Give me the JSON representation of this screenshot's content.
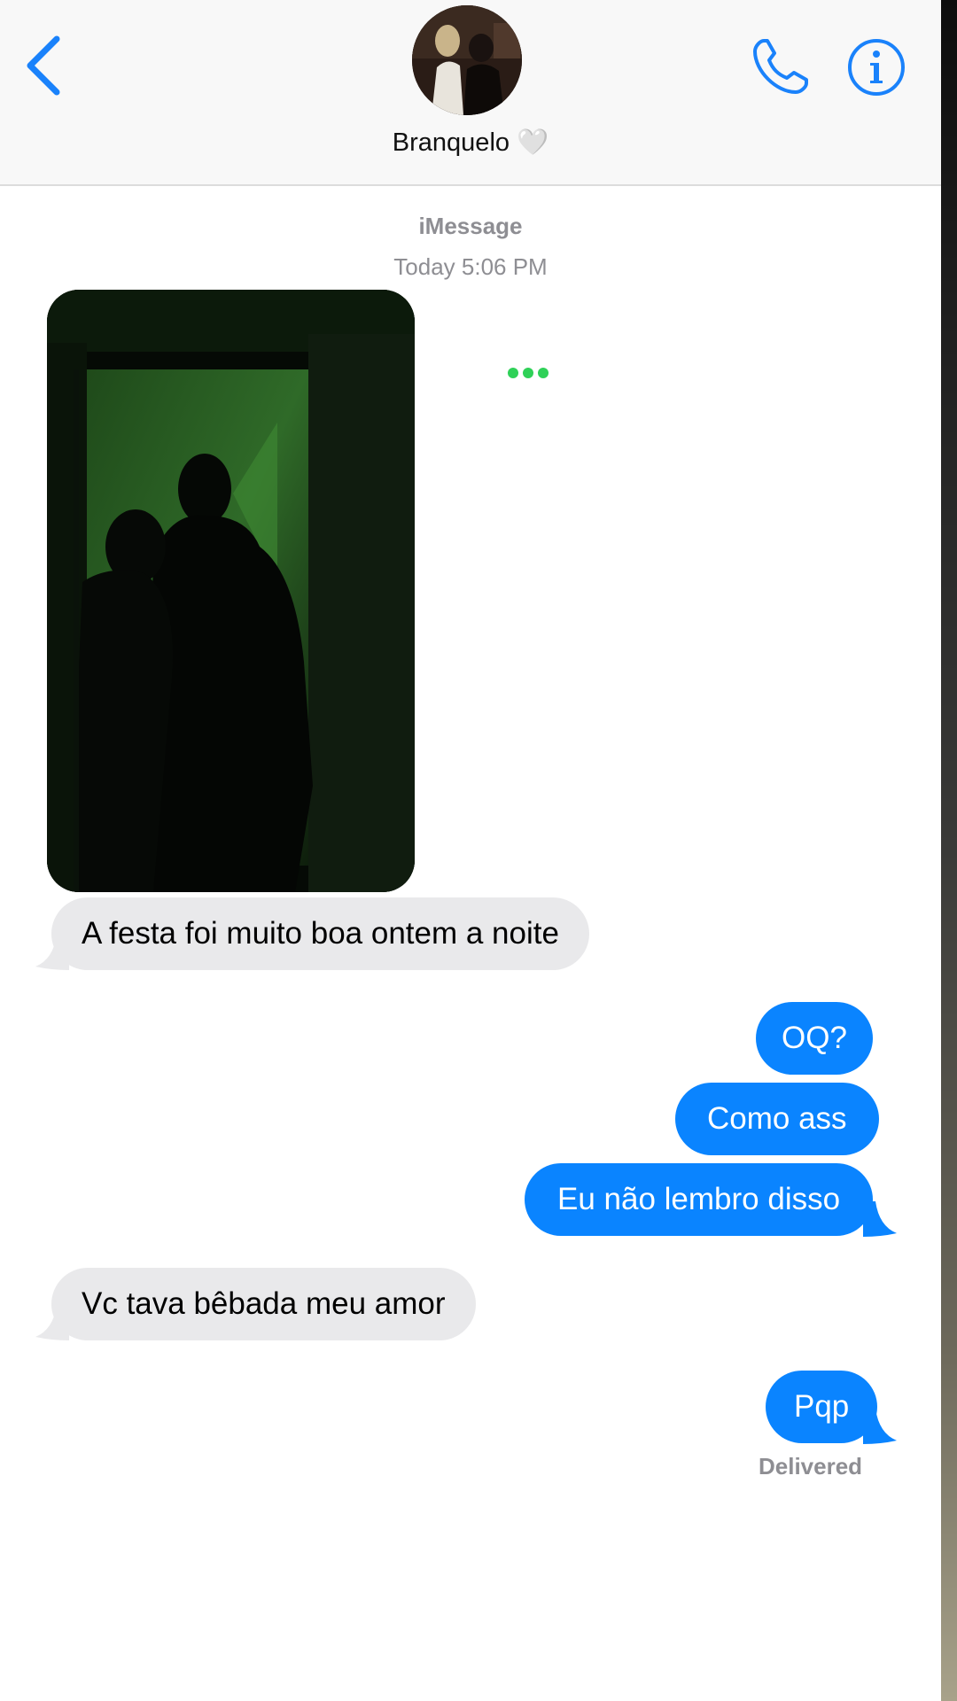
{
  "header": {
    "back_label": "Back",
    "contact_name": "Branquelo 🤍",
    "icons": [
      "chevron-left-icon",
      "phone-icon",
      "info-icon"
    ],
    "accent_color": "#1a82fb"
  },
  "conversation": {
    "service": "iMessage",
    "timestamp": "Today 5:06 PM",
    "typing_indicator_color": "#2fd158",
    "messages": [
      {
        "direction": "incoming",
        "type": "image"
      },
      {
        "direction": "incoming",
        "text": "A festa foi muito boa ontem a noite"
      },
      {
        "direction": "outgoing",
        "text": "OQ?"
      },
      {
        "direction": "outgoing",
        "text": "Como ass"
      },
      {
        "direction": "outgoing",
        "text": "Eu não lembro disso"
      },
      {
        "direction": "incoming",
        "text": "Vc tava bêbada meu amor"
      },
      {
        "direction": "outgoing",
        "text": "Pqp"
      }
    ],
    "status": "Delivered"
  },
  "colors": {
    "outgoing_bubble": "#0a84ff",
    "incoming_bubble": "#e9e9eb",
    "meta_text": "#8e8e93"
  }
}
